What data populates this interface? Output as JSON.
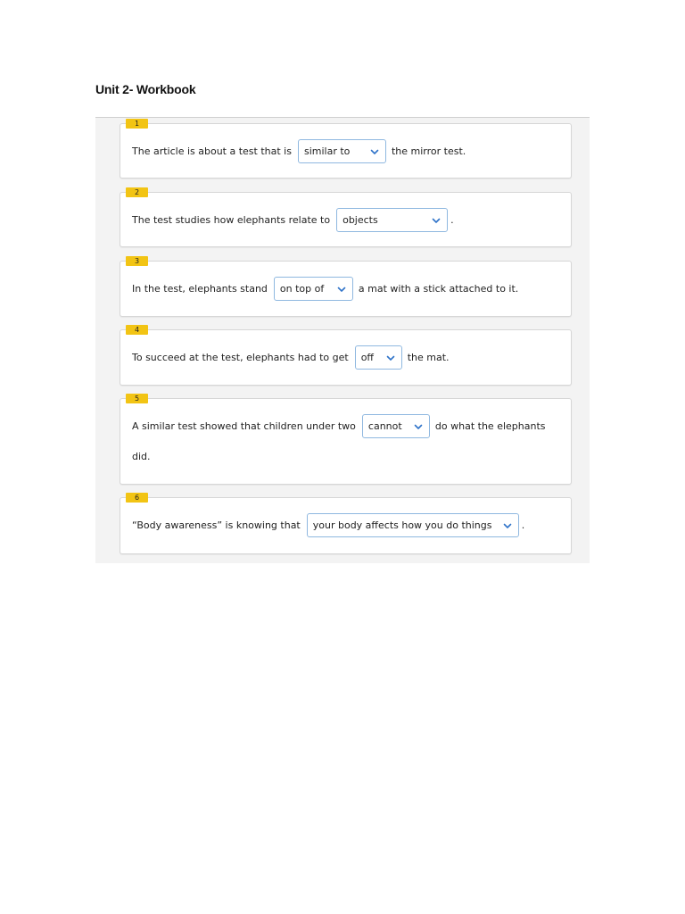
{
  "page": {
    "title": "Unit 2- Workbook"
  },
  "colors": {
    "badge": "#f2c414",
    "select_border": "#8fb8e0",
    "chevron": "#2f73c9"
  },
  "questions": [
    {
      "number": "1",
      "before": "The article is about a test that is",
      "selected": "similar to",
      "after": "the mirror test."
    },
    {
      "number": "2",
      "before": "The test studies how elephants relate to",
      "selected": "objects",
      "after": "."
    },
    {
      "number": "3",
      "before": "In the test, elephants stand",
      "selected": "on top of",
      "after": "a mat with a stick attached to it."
    },
    {
      "number": "4",
      "before": "To succeed at the test, elephants had to get",
      "selected": "off",
      "after": "the mat."
    },
    {
      "number": "5",
      "before": "A similar test showed that children under two",
      "selected": "cannot",
      "after": "do what the elephants",
      "after_line2": "did."
    },
    {
      "number": "6",
      "before": "“Body awareness” is knowing that",
      "selected": "your body affects how you do things",
      "after": "."
    }
  ]
}
